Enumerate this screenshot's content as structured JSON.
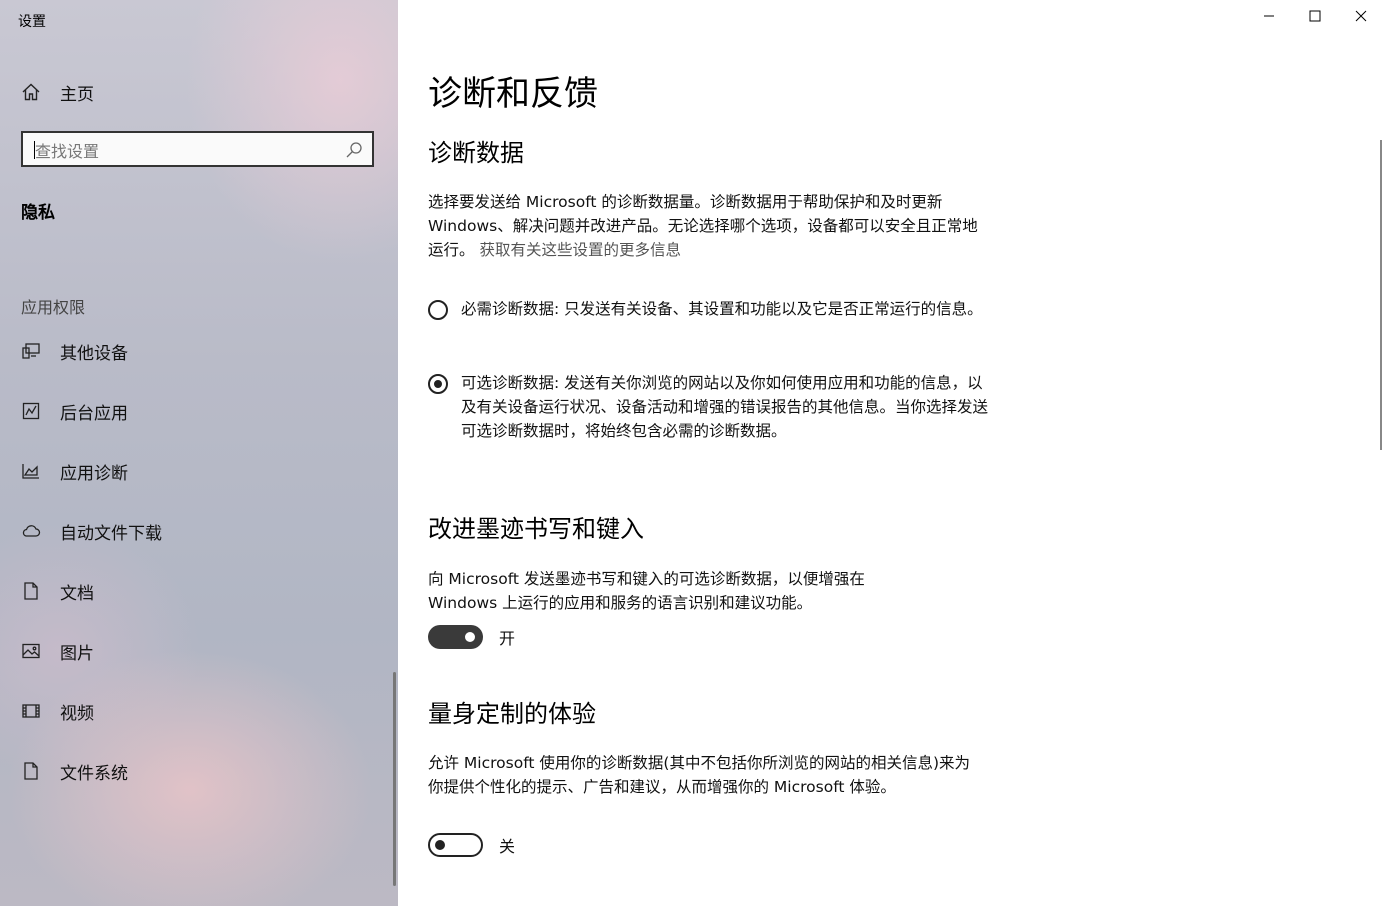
{
  "window": {
    "title": "设置",
    "controls": [
      "minimize-icon",
      "maximize-icon",
      "close-icon"
    ]
  },
  "sidebar": {
    "home_label": "主页",
    "search": {
      "placeholder": "查找设置",
      "value": ""
    },
    "current_section": "隐私",
    "group_label": "应用权限",
    "items": [
      {
        "label": "其他设备",
        "icon": "devices-icon"
      },
      {
        "label": "后台应用",
        "icon": "background-apps-icon"
      },
      {
        "label": "应用诊断",
        "icon": "app-diagnostics-icon"
      },
      {
        "label": "自动文件下载",
        "icon": "cloud-icon"
      },
      {
        "label": "文档",
        "icon": "document-icon"
      },
      {
        "label": "图片",
        "icon": "picture-icon"
      },
      {
        "label": "视频",
        "icon": "video-icon"
      },
      {
        "label": "文件系统",
        "icon": "file-icon"
      }
    ]
  },
  "main": {
    "page_title": "诊断和反馈",
    "diagnostic": {
      "heading": "诊断数据",
      "description": "选择要发送给 Microsoft 的诊断数据量。诊断数据用于帮助保护和及时更新 Windows、解决问题并改进产品。无论选择哪个选项，设备都可以安全且正常地运行。",
      "link": "获取有关这些设置的更多信息",
      "options": [
        {
          "label": "必需诊断数据: 只发送有关设备、其设置和功能以及它是否正常运行的信息。",
          "selected": false
        },
        {
          "label": "可选诊断数据: 发送有关你浏览的网站以及你如何使用应用和功能的信息，以及有关设备运行状况、设备活动和增强的错误报告的其他信息。当你选择发送可选诊断数据时，将始终包含必需的诊断数据。",
          "selected": true
        }
      ]
    },
    "inking": {
      "heading": "改进墨迹书写和键入",
      "description": "向 Microsoft 发送墨迹书写和键入的可选诊断数据，以便增强在 Windows 上运行的应用和服务的语言识别和建议功能。",
      "toggle_state": "on",
      "toggle_label": "开"
    },
    "tailored": {
      "heading": "量身定制的体验",
      "description": "允许 Microsoft 使用你的诊断数据(其中不包括你所浏览的网站的相关信息)来为你提供个性化的提示、广告和建议，从而增强你的 Microsoft 体验。",
      "toggle_state": "off",
      "toggle_label": "关"
    }
  }
}
